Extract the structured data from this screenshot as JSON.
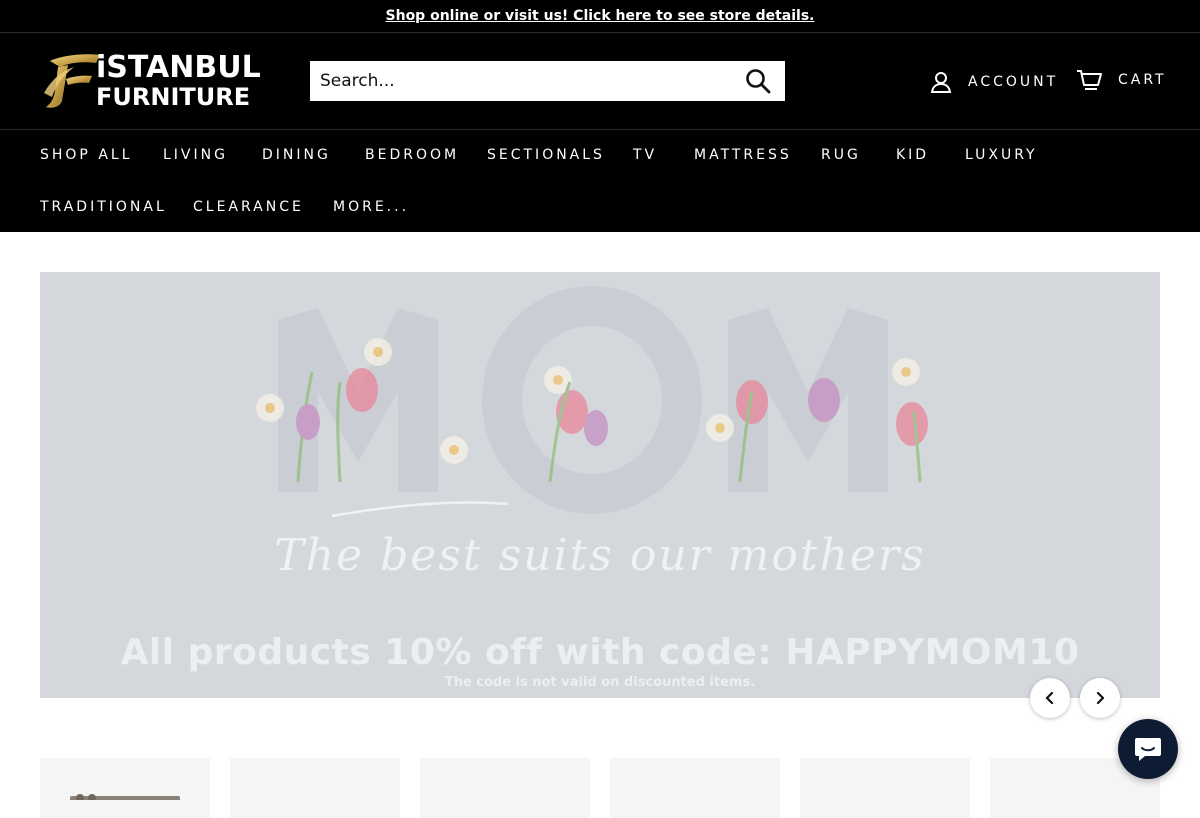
{
  "announcement": {
    "text": "Shop online or visit us! Click here to see store details."
  },
  "logo": {
    "line1": "iSTANBUL",
    "line2": "FURNITURE"
  },
  "search": {
    "placeholder": "Search..."
  },
  "header": {
    "account_label": "ACCOUNT",
    "cart_label": "CART"
  },
  "nav": {
    "row1": [
      "SHOP ALL",
      "LIVING",
      "DINING",
      "BEDROOM",
      "SECTIONALS",
      "TV",
      "MATTRESS",
      "RUG",
      "KID",
      "LUXURY"
    ],
    "row2": [
      "TRADITIONAL",
      "CLEARANCE",
      "MORE..."
    ]
  },
  "hero": {
    "word": "MOM",
    "tagline": "The best suits our mothers",
    "promo": "All products 10% off with code: HAPPYMOM10",
    "note": "The code is not valid on discounted items."
  },
  "colors": {
    "brand_gold": "#c9a24a",
    "bar_bg": "#000000",
    "hero_bg": "#d4d7dc",
    "chat_bg": "#0d1b33"
  },
  "icons": [
    "search-icon",
    "account-icon",
    "cart-icon",
    "chevron-left-icon",
    "chevron-right-icon",
    "chat-icon"
  ]
}
